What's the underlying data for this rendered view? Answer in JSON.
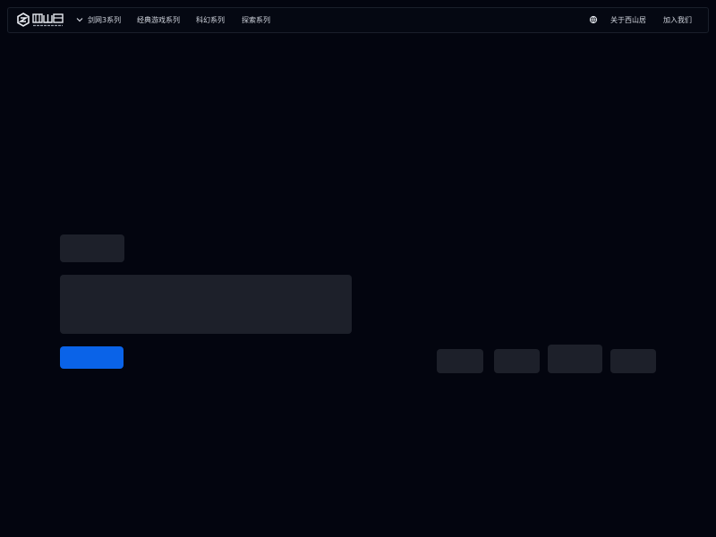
{
  "brand": {
    "logo_icon": "seasun-logo-icon",
    "accent_color": "#0a63e8",
    "background_color": "#03050f",
    "placeholder_color": "#1d202a"
  },
  "nav": {
    "items": [
      {
        "label": "剑网3系列"
      },
      {
        "label": "经典游戏系列"
      },
      {
        "label": "科幻系列"
      },
      {
        "label": "探索系列"
      }
    ],
    "language_icon": "globe-icon",
    "about_label": "关于西山居",
    "join_label": "加入我们"
  },
  "hero": {
    "tag_placeholder": "",
    "title_placeholder": "",
    "cta_label": ""
  },
  "thumbnails": {
    "count": 4
  }
}
